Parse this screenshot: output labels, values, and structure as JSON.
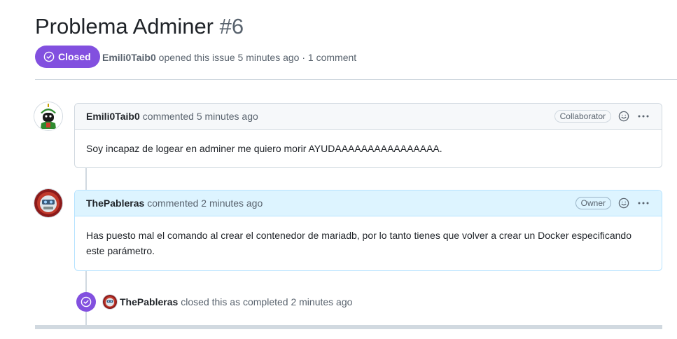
{
  "issue": {
    "title": "Problema Adminer",
    "number": "#6",
    "state_label": "Closed",
    "author": "Emili0Taib0",
    "meta_text": "opened this issue 5 minutes ago · 1 comment"
  },
  "comments": [
    {
      "author": "Emili0Taib0",
      "action": "commented 5 minutes ago",
      "role": "Collaborator",
      "body": "Soy incapaz de logear en adminer me quiero morir AYUDAAAAAAAAAAAAAAAA."
    },
    {
      "author": "ThePableras",
      "action": "commented 2 minutes ago",
      "role": "Owner",
      "body": "Has puesto mal el comando al crear el contenedor de mariadb, por lo tanto tienes que volver a crear un Docker especificando este parámetro."
    }
  ],
  "event": {
    "author": "ThePableras",
    "text": "closed this as completed 2 minutes ago"
  },
  "colors": {
    "closed_purple": "#8250df",
    "owner_header": "#ddf4ff",
    "border": "#d1d9e0"
  }
}
